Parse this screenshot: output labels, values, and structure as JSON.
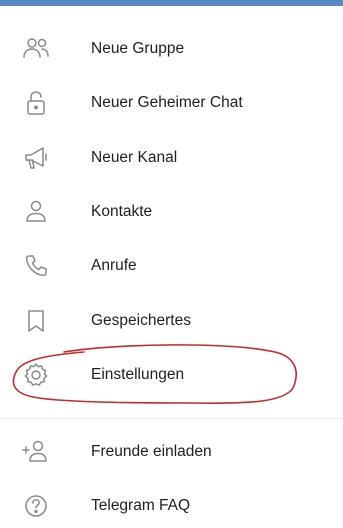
{
  "menu": {
    "items": [
      {
        "label": "Neue Gruppe",
        "icon": "group-icon"
      },
      {
        "label": "Neuer Geheimer Chat",
        "icon": "lock-icon"
      },
      {
        "label": "Neuer Kanal",
        "icon": "megaphone-icon"
      },
      {
        "label": "Kontakte",
        "icon": "person-icon"
      },
      {
        "label": "Anrufe",
        "icon": "phone-icon"
      },
      {
        "label": "Gespeichertes",
        "icon": "bookmark-icon"
      },
      {
        "label": "Einstellungen",
        "icon": "gear-icon"
      },
      {
        "label": "Freunde einladen",
        "icon": "add-person-icon"
      },
      {
        "label": "Telegram FAQ",
        "icon": "help-icon"
      }
    ]
  },
  "colors": {
    "header": "#5a8ac4",
    "icon": "#8a8a8a",
    "text": "#1f1f1f",
    "annotation": "#c42b2b"
  }
}
